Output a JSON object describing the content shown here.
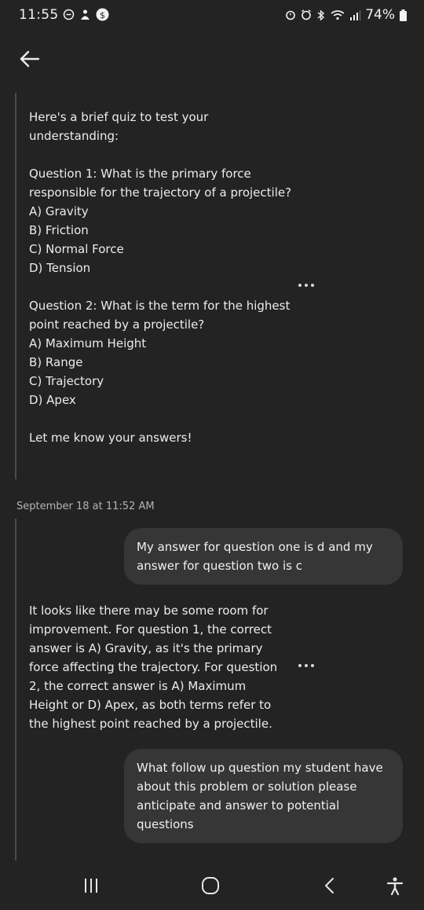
{
  "status": {
    "time": "11:55",
    "battery": "74%"
  },
  "icons": {
    "back": "arrow-left-icon",
    "nav_recents": "recent-apps-icon",
    "nav_home": "home-icon",
    "nav_back": "nav-back-icon",
    "nav_accessibility": "accessibility-icon"
  },
  "messages": {
    "bot1": {
      "lines": [
        "Here's a brief quiz to test your understanding:",
        "",
        "Question 1: What is the primary force responsible for the trajectory of a projectile?",
        "A) Gravity",
        "B) Friction",
        "C) Normal Force",
        "D) Tension",
        "",
        "Question 2: What is the term for the highest point reached by a projectile?",
        "A) Maximum Height",
        "B) Range",
        "C) Trajectory",
        "D) Apex",
        "",
        "Let me know your answers!"
      ]
    },
    "timestamp": "September 18 at 11:52 AM",
    "user1": "My answer for question one is d and my answer for question two is c",
    "bot2": "It looks like there may be some room for improvement. For question 1, the correct answer is A) Gravity, as it's the primary force affecting the trajectory. For question 2, the correct answer is A) Maximum Height or D) Apex, as both terms refer to the highest point reached by a projectile.",
    "user2": "What follow up question my student have about this problem or solution please anticipate and answer to potential questions"
  }
}
